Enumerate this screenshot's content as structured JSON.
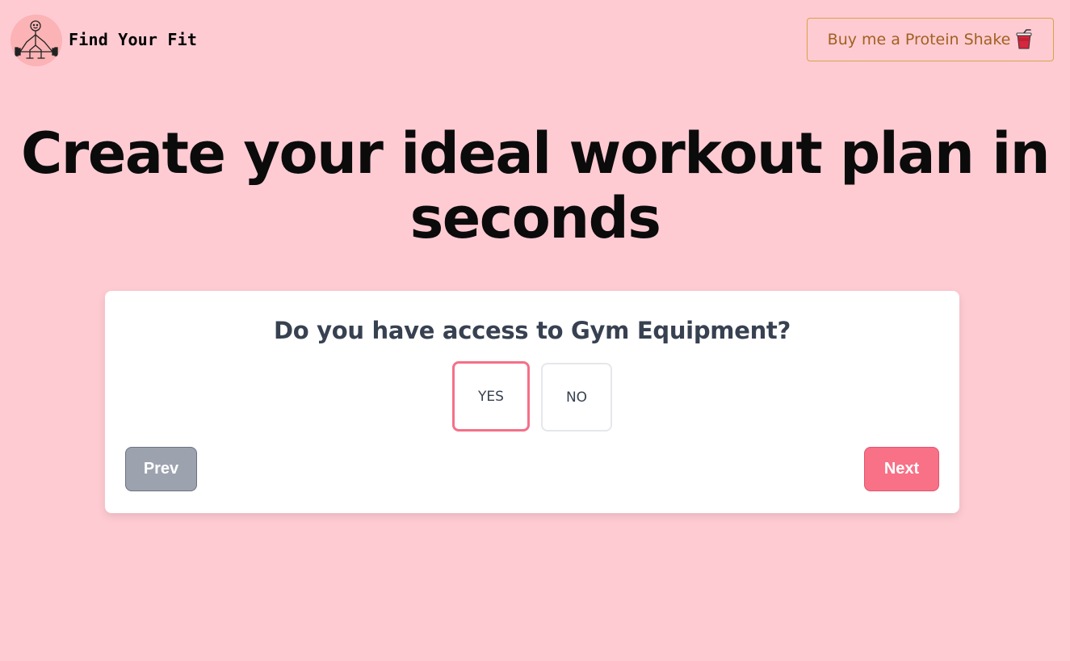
{
  "header": {
    "brand_name": "Find Your Fit",
    "logo_icon": "weightlifter-stick-figure-icon",
    "support_button_label": "Buy me a Protein Shake",
    "support_button_icon": "cup-with-straw-icon"
  },
  "hero": {
    "title_line1": "Create your ideal workout plan in",
    "title_line2": "seconds"
  },
  "quiz": {
    "question": "Do you have access to Gym Equipment?",
    "options": [
      {
        "label": "YES",
        "selected": true
      },
      {
        "label": "NO",
        "selected": false
      }
    ],
    "prev_label": "Prev",
    "next_label": "Next"
  },
  "colors": {
    "background": "#ffcbd3",
    "accent": "#f87187",
    "secondary_button": "#9ca3af",
    "support_button_text": "#a0611f"
  }
}
